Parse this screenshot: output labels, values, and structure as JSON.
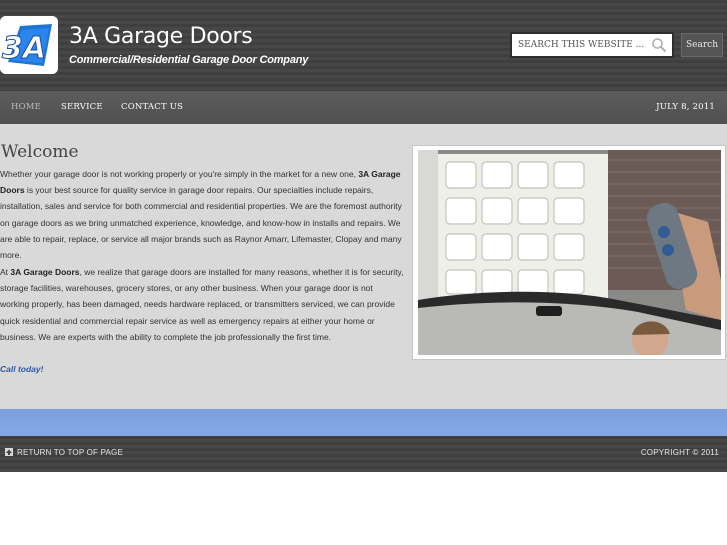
{
  "header": {
    "logo_text": "3A",
    "site_title": "3A Garage Doors",
    "tagline": "Commercial/Residential Garage Door Company",
    "search_placeholder": "SEARCH THIS WEBSITE ...",
    "search_button": "Search"
  },
  "nav": {
    "items": [
      {
        "label": "HOME"
      },
      {
        "label": "SERVICE"
      },
      {
        "label": "CONTACT US"
      }
    ],
    "date": "JULY 8, 2011"
  },
  "content": {
    "heading": "Welcome",
    "p1_a": "Whether your garage door is not working properly or you're simply in the market for a new one, ",
    "p1_b": "3A Garage Doors",
    "p1_c": " is your best source for quality service in garage door repairs.  Our specialties include repairs, installation, sales and service for both commercial and residential properties.  We are the foremost authority on garage doors as we bring unmatched experience, knowledge, and know-how in installs and repairs. We are able to repair, replace, or service all major brands such as Raynor Amarr, Lifemaster, Clopay and many more.",
    "p2_a": "At ",
    "p2_b": "3A Garage Doors",
    "p2_c": ", we realize that garage doors are installed for many reasons, whether it is for security, storage facilities, warehouses, grocery stores, or any other business. When your garage door is not working properly, has been damaged, needs hardware replaced, or transmitters serviced, we can provide quick residential and commercial repair service as well as emergency repairs at either your home or business.  We are experts with the ability to complete the job professionally the first time.",
    "call_to_action": "Call today!"
  },
  "footer": {
    "return_top": "RETURN TO TOP OF PAGE",
    "copyright": "COPYRIGHT © 2011"
  },
  "colors": {
    "header_bg": "#444444",
    "nav_bg": "#575757",
    "content_bg": "#d9d9d9",
    "accent_link": "#2b5aa8",
    "band_blue": "#7f9fe2"
  }
}
